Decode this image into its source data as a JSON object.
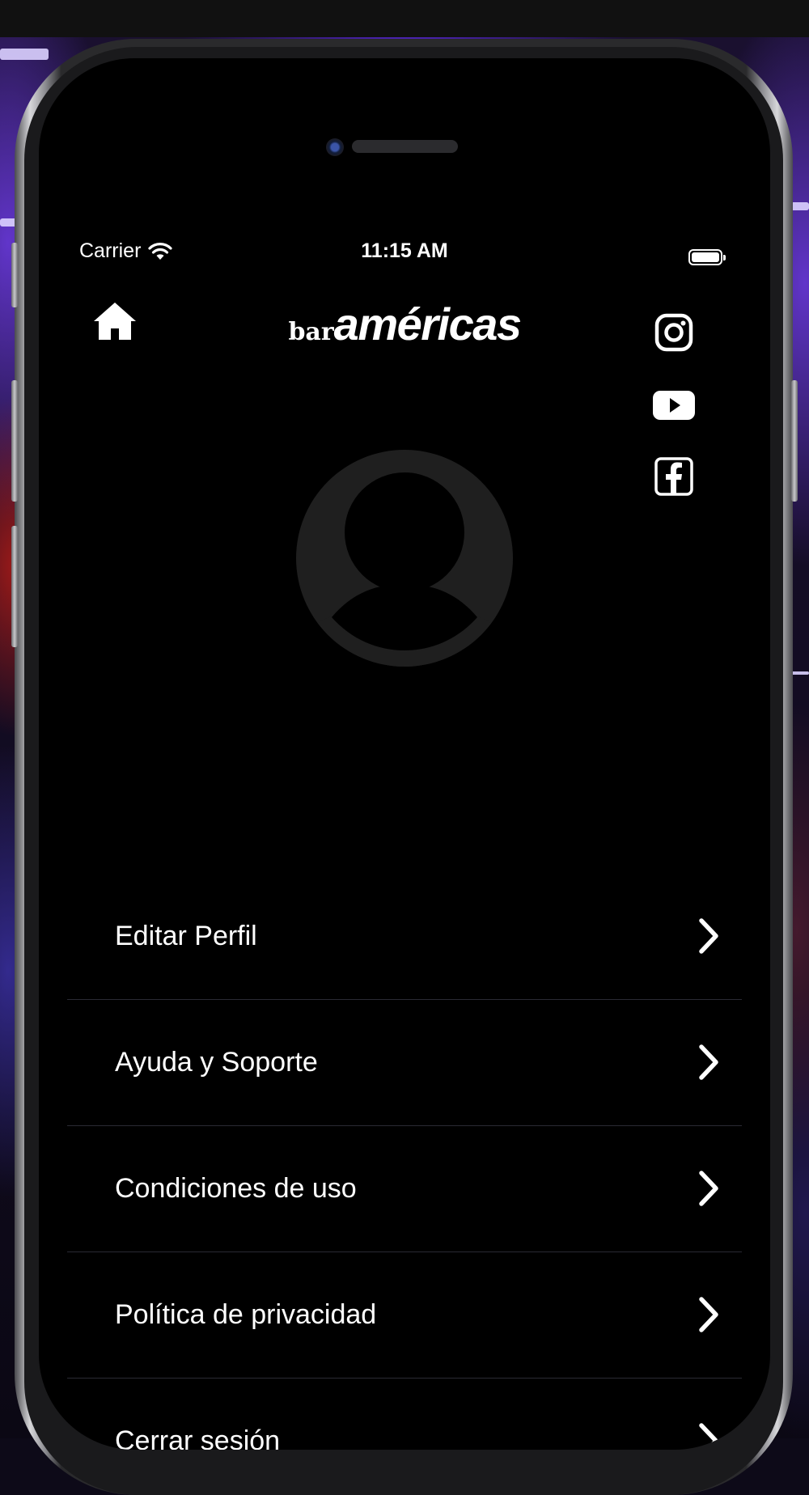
{
  "status_bar": {
    "carrier": "Carrier",
    "time": "11:15 AM"
  },
  "header": {
    "logo_prefix": "bar",
    "logo_main": "américas",
    "home_icon": "home-icon"
  },
  "social_links": [
    {
      "name": "instagram",
      "icon": "instagram-icon"
    },
    {
      "name": "youtube",
      "icon": "youtube-icon"
    },
    {
      "name": "facebook",
      "icon": "facebook-icon"
    }
  ],
  "profile": {
    "avatar_icon": "person-placeholder-icon"
  },
  "menu": {
    "items": [
      {
        "label": "Editar Perfil"
      },
      {
        "label": "Ayuda y Soporte"
      },
      {
        "label": "Condiciones de uso"
      },
      {
        "label": "Política de privacidad"
      },
      {
        "label": "Cerrar sesión"
      }
    ],
    "chevron_icon": "chevron-right-icon"
  },
  "colors": {
    "screen_background": "#000000",
    "text": "#ffffff",
    "avatar": "#1f1f1f",
    "separator": "#2a2a33"
  }
}
